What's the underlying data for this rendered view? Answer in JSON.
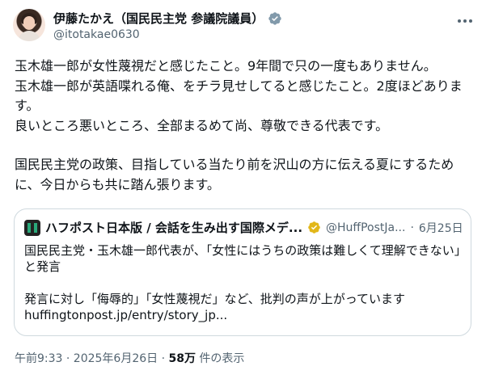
{
  "author": {
    "display_name": "伊藤たかえ（国民民主党 参議院議員）",
    "handle": "@itotakae0630",
    "verified_color": "#829aab"
  },
  "tweet": {
    "lines": [
      "玉木雄一郎が女性蔑視だと感じたこと。9年間で只の一度もありません。",
      "玉木雄一郎が英語喋れる俺、をチラ見せしてると感じたこと。2度ほどあります。",
      "良いところ悪いところ、全部まるめて尚、尊敬できる代表です。",
      "国民民主党の政策、目指している当たり前を沢山の方に伝える夏にするために、今日からも共に踏ん張ります。"
    ]
  },
  "quote": {
    "source_name": "ハフポスト日本版 / 会話を生み出す国際メデ...",
    "source_handle": "@HuffPostJa...",
    "separator": "·",
    "date": "6月25日",
    "badge_color": "#e2b719",
    "text_line1": "国民民主党・玉木雄一郎代表が、「女性にはうちの政策は難しくて理解できない」と発言",
    "text_line2": "発言に対し「侮辱的」「女性蔑視だ」など、批判の声が上がっています",
    "link": "huffingtonpost.jp/entry/story_jp..."
  },
  "footer": {
    "timestamp": "午前9:33 · 2025年6月26日",
    "separator": " · ",
    "views_count": "58万",
    "views_label": " 件の表示"
  }
}
